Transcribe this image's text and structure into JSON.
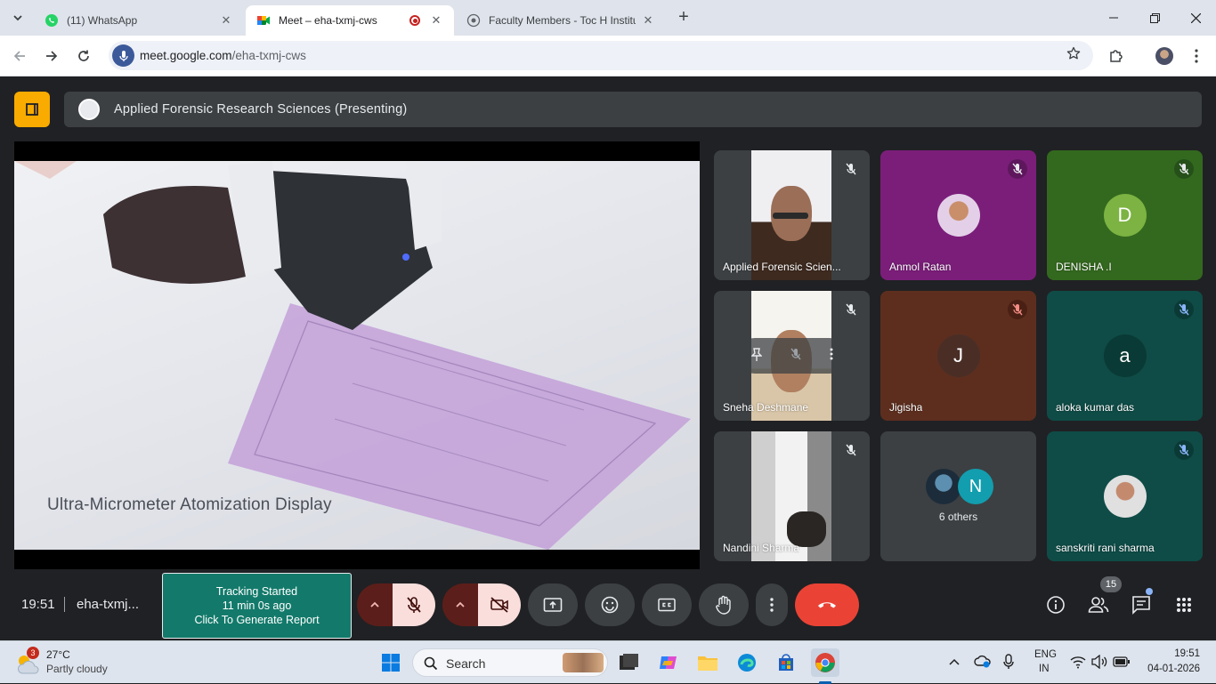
{
  "browser": {
    "tabs": [
      {
        "title": "(11) WhatsApp",
        "close": "✕"
      },
      {
        "title": "Meet – eha-txmj-cws",
        "close": "✕"
      },
      {
        "title": "Faculty Members - Toc H Institu",
        "close": "✕"
      }
    ],
    "new_tab": "+",
    "url_host": "meet.google.com",
    "url_path": "/eha-txmj-cws"
  },
  "meet": {
    "presenting_title": "Applied Forensic Research Sciences (Presenting)",
    "shared_caption": "Ultra-Micrometer Atomization Display",
    "participants": [
      {
        "name": "Applied Forensic Scien...",
        "kind": "video"
      },
      {
        "name": "Anmol Ratan",
        "kind": "photo"
      },
      {
        "name": "DENISHA .I",
        "kind": "letter",
        "letter": "D"
      },
      {
        "name": "Sneha Deshmane",
        "kind": "video"
      },
      {
        "name": "Jigisha",
        "kind": "letter",
        "letter": "J"
      },
      {
        "name": "aloka kumar das",
        "kind": "letter",
        "letter": "a"
      },
      {
        "name": "Nandini Sharma",
        "kind": "video"
      },
      {
        "name": "6 others",
        "kind": "others",
        "letter": "N"
      },
      {
        "name": "sanskriti rani sharma",
        "kind": "photo"
      }
    ],
    "clock": "19:51",
    "meeting_code": "eha-txmj...",
    "tracking": {
      "line1": "Tracking Started",
      "line2": "11 min 0s ago",
      "line3": "Click To Generate Report"
    },
    "participant_count": "15"
  },
  "taskbar": {
    "weather_badge": "3",
    "weather_temp": "27°C",
    "weather_desc": "Partly cloudy",
    "search_label": "Search",
    "lang_line1": "ENG",
    "lang_line2": "IN",
    "time": "19:51",
    "date": "04-01-2026"
  },
  "colors": {
    "meet_bg": "#202124",
    "end_call": "#ea4335",
    "tracking_bg": "#137a6b",
    "presenting_badge": "#f9ab00"
  }
}
